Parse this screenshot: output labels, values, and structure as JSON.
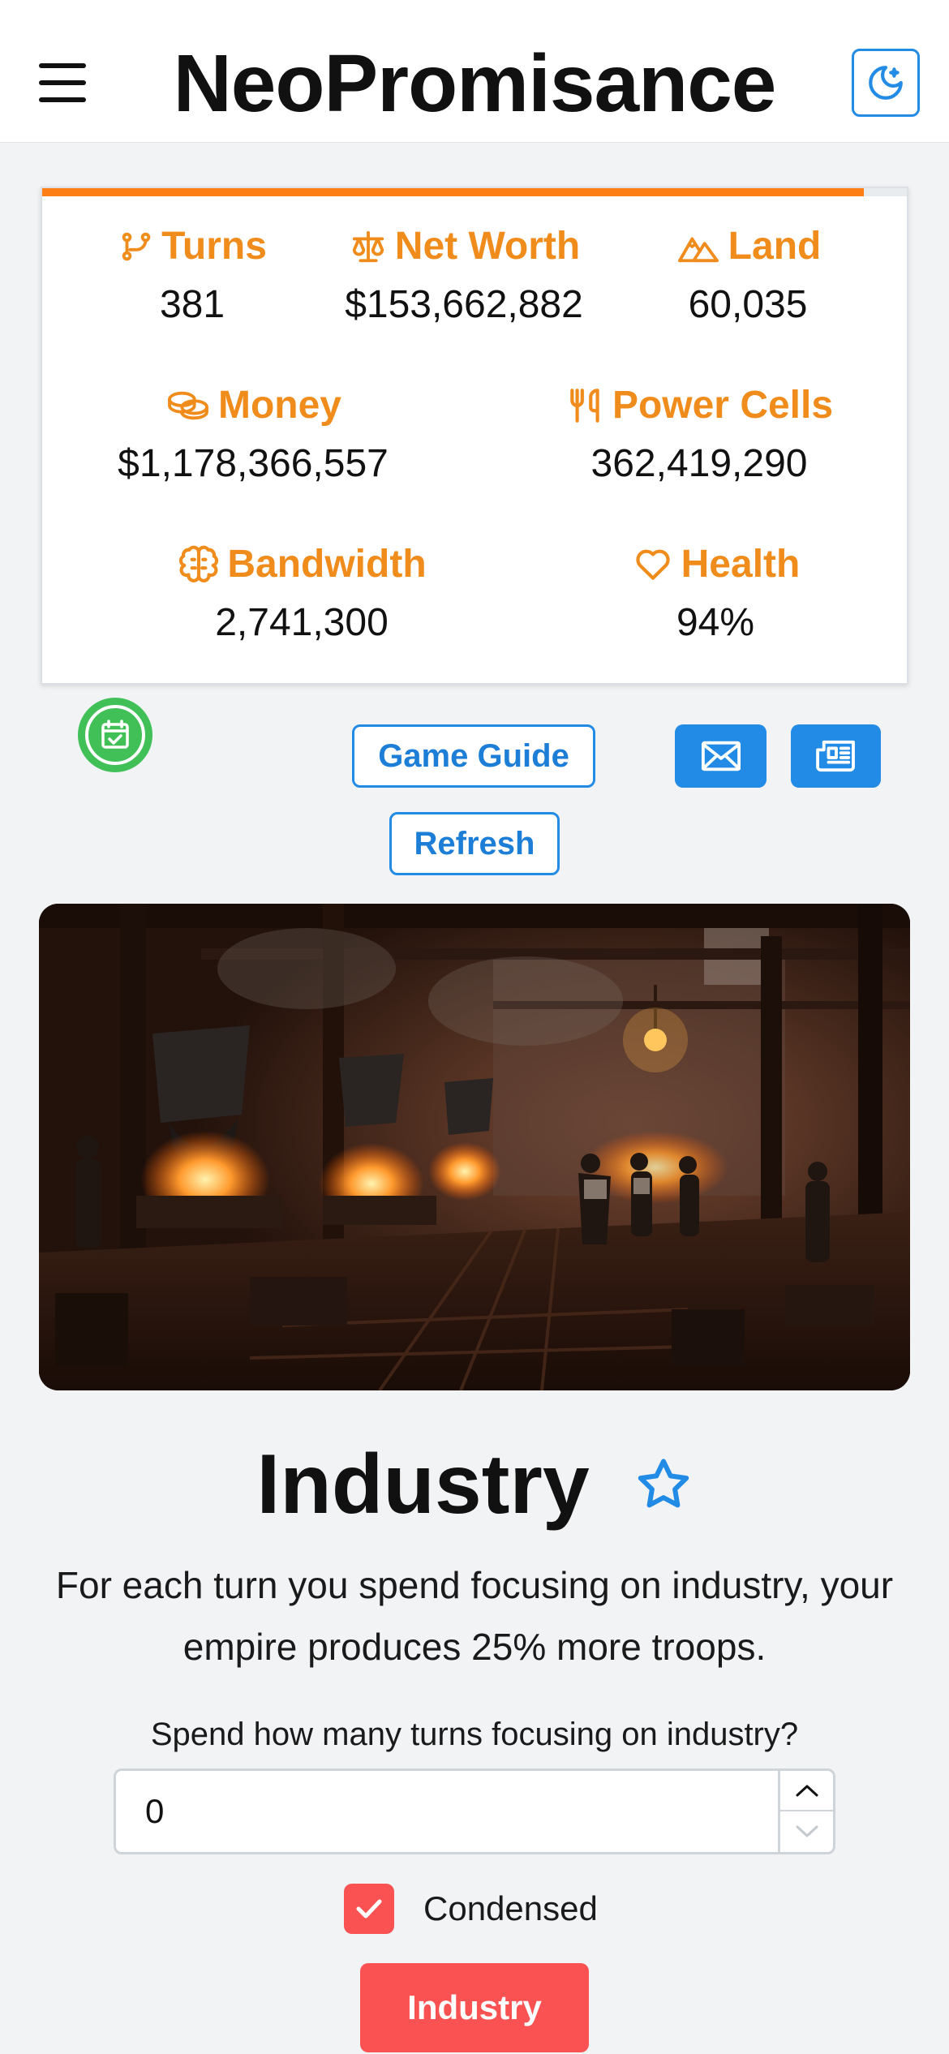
{
  "header": {
    "title": "NeoPromisance",
    "menu_icon": "hamburger-menu-icon",
    "theme_icon": "moon-icon"
  },
  "stats": {
    "turns_progress_percent": 95,
    "turns": {
      "label": "Turns",
      "value": "381",
      "icon": "git-branch-icon"
    },
    "net_worth": {
      "label": "Net Worth",
      "value": "$153,662,882",
      "icon": "scale-icon"
    },
    "land": {
      "label": "Land",
      "value": "60,035",
      "icon": "mountains-icon"
    },
    "money": {
      "label": "Money",
      "value": "$1,178,366,557",
      "icon": "coins-icon"
    },
    "power_cells": {
      "label": "Power Cells",
      "value": "362,419,290",
      "icon": "fork-knife-icon"
    },
    "bandwidth": {
      "label": "Bandwidth",
      "value": "2,741,300",
      "icon": "brain-icon"
    },
    "health": {
      "label": "Health",
      "value": "94%",
      "icon": "heart-icon"
    }
  },
  "actions": {
    "game_guide_label": "Game Guide",
    "refresh_label": "Refresh",
    "timer_icon": "calendar-check-icon",
    "mail_icon": "mail-icon",
    "news_icon": "newspaper-icon"
  },
  "page": {
    "title": "Industry",
    "favorite_icon": "star-icon",
    "description": "For each turn you spend focusing on industry, your empire produces 25% more troops.",
    "spend_label": "Spend how many turns focusing on industry?",
    "turns_input_value": "0",
    "condensed_label": "Condensed",
    "condensed_checked": true,
    "submit_label": "Industry"
  },
  "colors": {
    "accent_orange": "#f08c1c",
    "primary_blue": "#228be6",
    "danger_red": "#fa5252",
    "timer_green": "#40c057"
  }
}
